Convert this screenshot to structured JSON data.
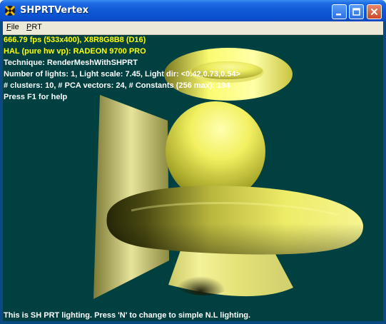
{
  "window": {
    "title": "SHPRTVertex"
  },
  "menubar": {
    "file_label": "File",
    "file_accel": "F",
    "file_rest": "ile",
    "prt_label": "PRT",
    "prt_accel": "P",
    "prt_rest": "RT"
  },
  "hud": {
    "stats_line": "666.79 fps (533x400), X8R8G8B8 (D16)",
    "device_line": "HAL (pure hw vp): RADEON 9700 PRO",
    "technique_line": "Technique: RenderMeshWithSHPRT",
    "lights_line": "Number of lights: 1, Light scale: 7.45, Light dir: <0.42,0.73,0.54>",
    "clusters_line": "# clusters: 10, # PCA vectors: 24, # Constants (256 max): 194",
    "help_line": "Press F1 for help",
    "footer_line": "This is SH PRT lighting.  Press 'N' to change to simple N.L lighting."
  },
  "colors": {
    "viewport_bg": "#004040",
    "hud_yellow": "#ffff00",
    "hud_white": "#ffffff",
    "mesh_yellow": "#f0f080"
  },
  "icons": {
    "app": "directx-icon",
    "minimize": "minimize-icon",
    "maximize": "maximize-icon",
    "close": "close-icon"
  }
}
